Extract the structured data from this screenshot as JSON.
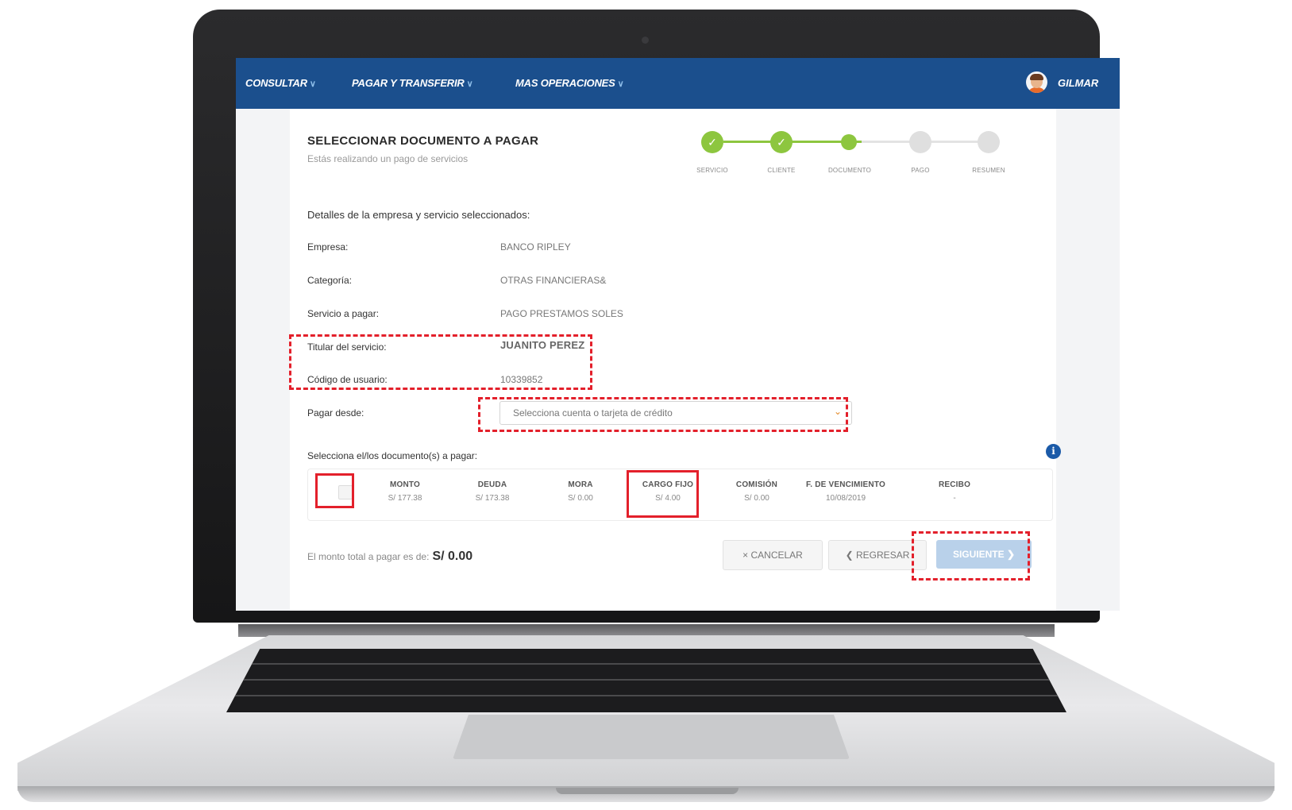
{
  "nav": {
    "items": [
      {
        "label": "CONSULTAR"
      },
      {
        "label": "PAGAR Y TRANSFERIR"
      },
      {
        "label": "MAS OPERACIONES"
      }
    ],
    "chevron": "∨",
    "user_name": "GILMAR"
  },
  "page": {
    "title": "SELECCIONAR DOCUMENTO A PAGAR",
    "subtitle": "Estás realizando un pago de servicios"
  },
  "stepper": {
    "steps": [
      {
        "label": "SERVICIO",
        "state": "done"
      },
      {
        "label": "CLIENTE",
        "state": "done"
      },
      {
        "label": "DOCUMENTO",
        "state": "current"
      },
      {
        "label": "PAGO",
        "state": "pending"
      },
      {
        "label": "RESUMEN",
        "state": "pending"
      }
    ],
    "check_glyph": "✓"
  },
  "details": {
    "heading": "Detalles de la empresa y servicio seleccionados:",
    "rows": [
      {
        "label": "Empresa:",
        "value": "BANCO RIPLEY"
      },
      {
        "label": "Categoría:",
        "value": "OTRAS FINANCIERAS&"
      },
      {
        "label": "Servicio a pagar:",
        "value": "PAGO PRESTAMOS SOLES"
      },
      {
        "label": "Titular del servicio:",
        "value": "JUANITO PEREZ"
      },
      {
        "label": "Código de usuario:",
        "value": "10339852"
      }
    ],
    "pay_from_label": "Pagar desde:",
    "pay_from_placeholder": "Selecciona cuenta o tarjeta de crédito"
  },
  "documents": {
    "heading": "Selecciona el/los documento(s) a pagar:",
    "columns": [
      {
        "header": "MONTO",
        "value": "S/ 177.38"
      },
      {
        "header": "DEUDA",
        "value": "S/ 173.38"
      },
      {
        "header": "MORA",
        "value": "S/ 0.00"
      },
      {
        "header": "CARGO FIJO",
        "value": "S/ 4.00"
      },
      {
        "header": "COMISIÓN",
        "value": "S/ 0.00"
      },
      {
        "header": "F. DE VENCIMIENTO",
        "value": "10/08/2019"
      },
      {
        "header": "RECIBO",
        "value": "-"
      }
    ]
  },
  "footer": {
    "total_label": "El monto total a pagar es de:",
    "total_value": "S/ 0.00",
    "cancel_label": "× CANCELAR",
    "back_label": "❮ REGRESAR",
    "next_label": "SIGUIENTE ❯"
  },
  "colors": {
    "topbar": "#1b4f8d",
    "step_done": "#8dc63f",
    "step_pending": "#dfdfdf",
    "callout": "#e3202b",
    "next_button": "#b9d1ea"
  }
}
